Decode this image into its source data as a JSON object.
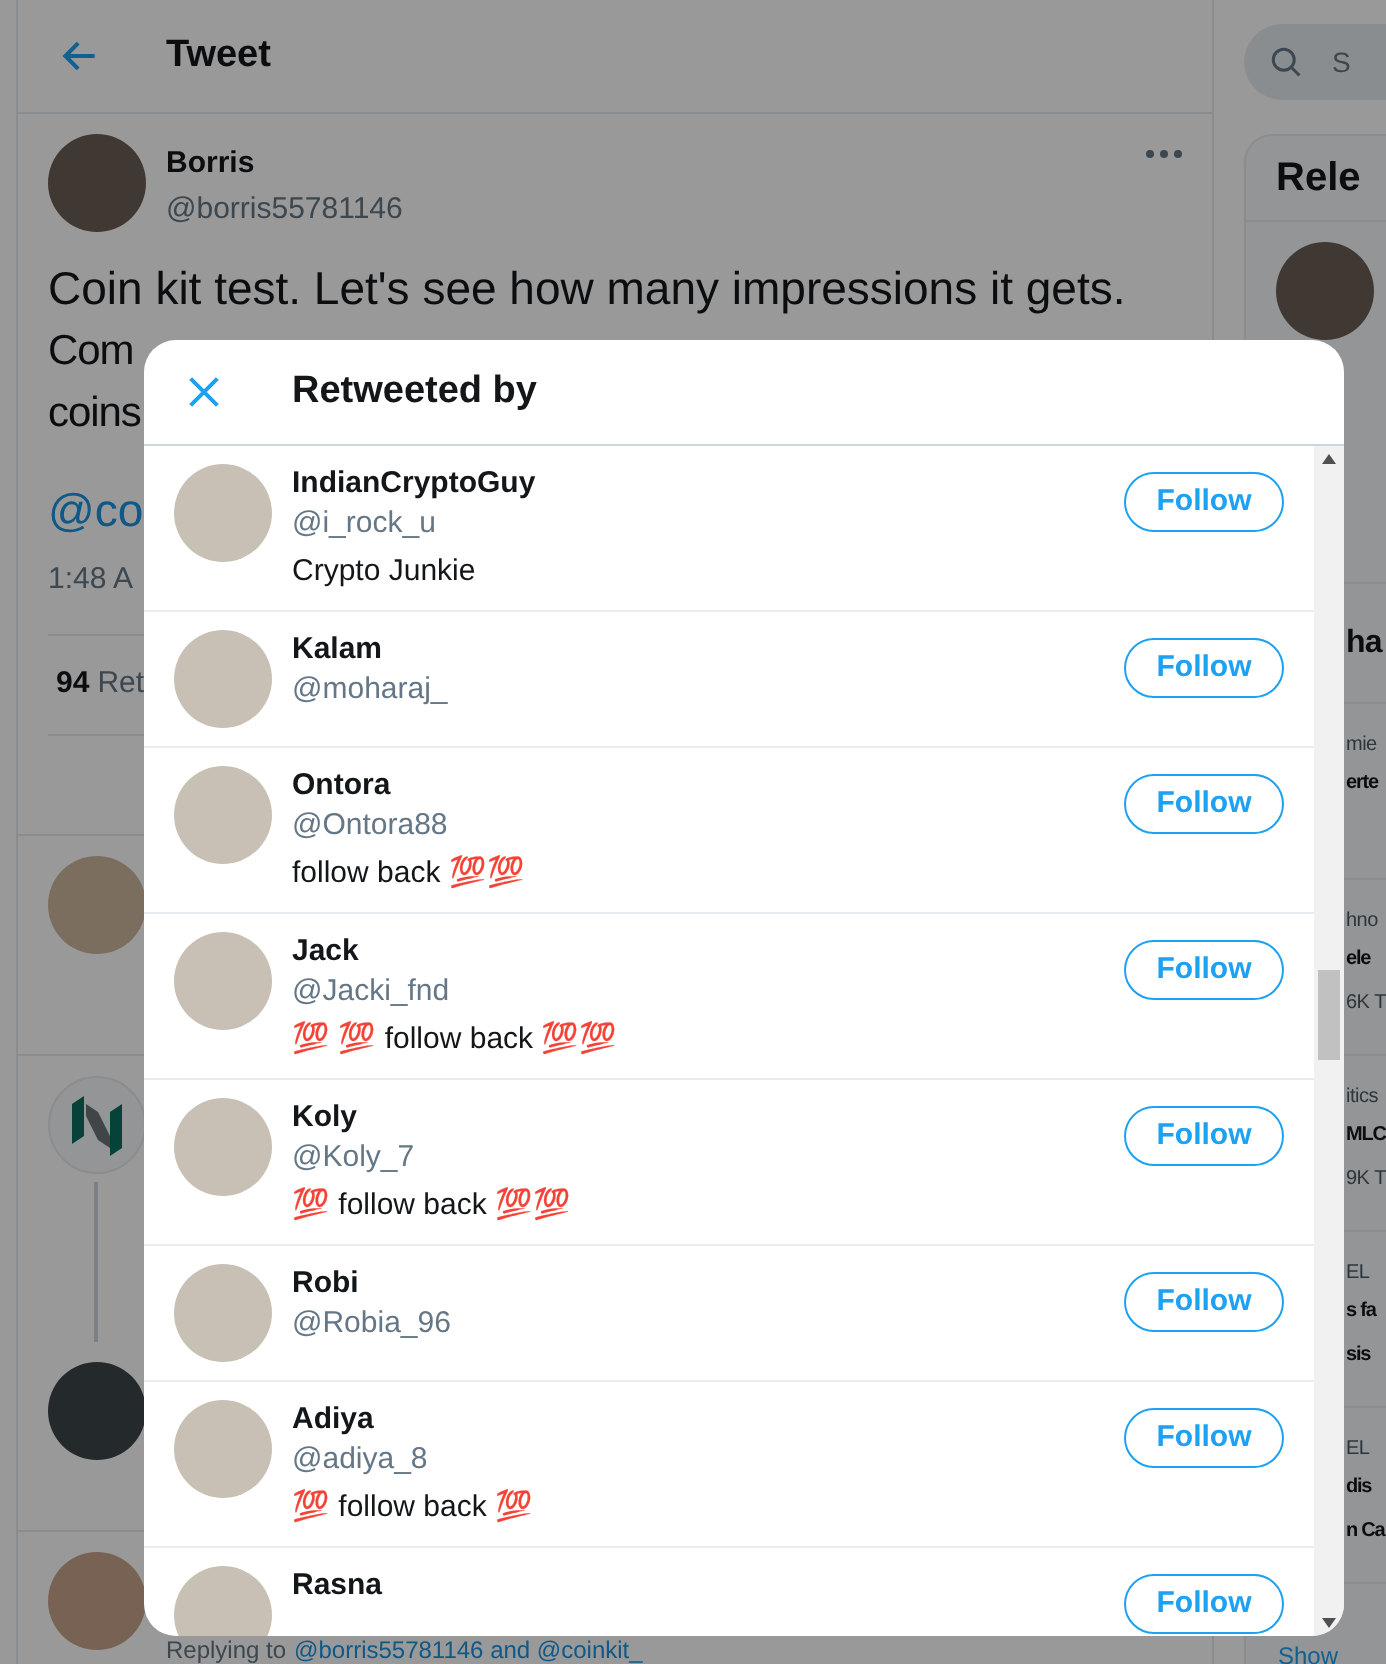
{
  "header": {
    "title": "Tweet"
  },
  "tweet": {
    "author": "Borris",
    "handle": "@borris55781146",
    "text": "Coin kit test. Let's see how many impressions it gets.",
    "fragments": [
      "Com",
      "coins"
    ],
    "mention": "@co",
    "time": "1:48 A",
    "stat_count": "94",
    "stat_label": "Ret"
  },
  "reply": {
    "prefix": "Replying to",
    "mentions": "@borris55781146 and @coinkit_"
  },
  "search": {
    "placeholder": "S"
  },
  "side_panel": {
    "title": "Rele",
    "heading": "ha",
    "trends": [
      {
        "category": "mie",
        "title": [
          "erte"
        ]
      },
      {
        "category": "hno",
        "title": [
          "ele"
        ],
        "count": "6K T"
      },
      {
        "category": "itics",
        "title": [
          "MLC"
        ],
        "count": "9K T"
      },
      {
        "category": "EL",
        "title": [
          "s fa",
          "sis"
        ]
      },
      {
        "category": "EL",
        "title": [
          "dis",
          "n Ca"
        ]
      }
    ],
    "link": "Show"
  },
  "dialog": {
    "title": "Retweeted by",
    "users": [
      {
        "name": "IndianCryptoGuy",
        "handle": "@i_rock_u",
        "bio": "Crypto Junkie",
        "button": "Follow"
      },
      {
        "name": "Kalam",
        "handle": "@moharaj_",
        "button": "Follow"
      },
      {
        "name": "Ontora",
        "handle": "@Ontora88",
        "bio": "follow back 💯💯",
        "button": "Follow"
      },
      {
        "name": "Jack",
        "handle": "@Jacki_fnd",
        "bio": "💯 💯 follow back 💯💯",
        "button": "Follow"
      },
      {
        "name": "Koly",
        "handle": "@Koly_7",
        "bio": "💯 follow back 💯💯",
        "button": "Follow"
      },
      {
        "name": "Robi",
        "handle": "@Robia_96",
        "button": "Follow"
      },
      {
        "name": "Adiya",
        "handle": "@adiya_8",
        "bio": "💯 follow back 💯",
        "button": "Follow"
      },
      {
        "name": "Rasna",
        "button": "Follow"
      }
    ]
  }
}
